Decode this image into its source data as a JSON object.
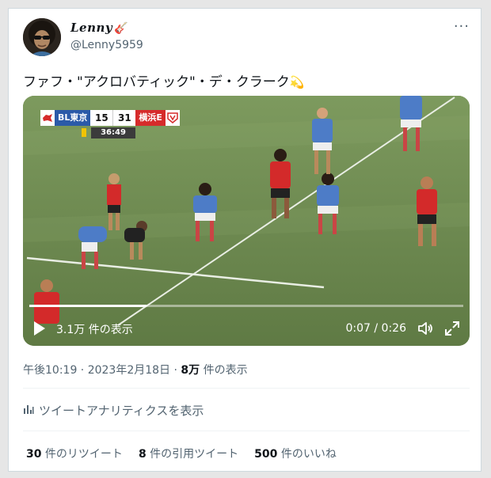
{
  "user": {
    "name": "Lenny",
    "handle": "@Lenny5959"
  },
  "more_label": "···",
  "tweet": {
    "text": "ファフ・\"アクロバティック\"・デ・クラーク",
    "emoji": "💫"
  },
  "video": {
    "scoreboard": {
      "team1": "BL東京",
      "score1": "15",
      "score2": "31",
      "team2": "横浜E",
      "clock": "36:49"
    },
    "views_label": "3.1万 件の表示",
    "time_label": "0:07 / 0:26",
    "progress": 0.27
  },
  "meta": {
    "timestamp": "午後10:19 · 2023年2月18日 · ",
    "views_count": "8万",
    "views_suffix": " 件の表示"
  },
  "analytics_label": "ツイートアナリティクスを表示",
  "stats": {
    "retweets_count": "30",
    "retweets_label": " 件のリツイート",
    "quotes_count": "8",
    "quotes_label": " 件の引用ツイート",
    "likes_count": "500",
    "likes_label": " 件のいいね"
  },
  "colors": {
    "team1": "#2b5aa8",
    "team2": "#d62b2b",
    "secondary_text": "#536471"
  }
}
